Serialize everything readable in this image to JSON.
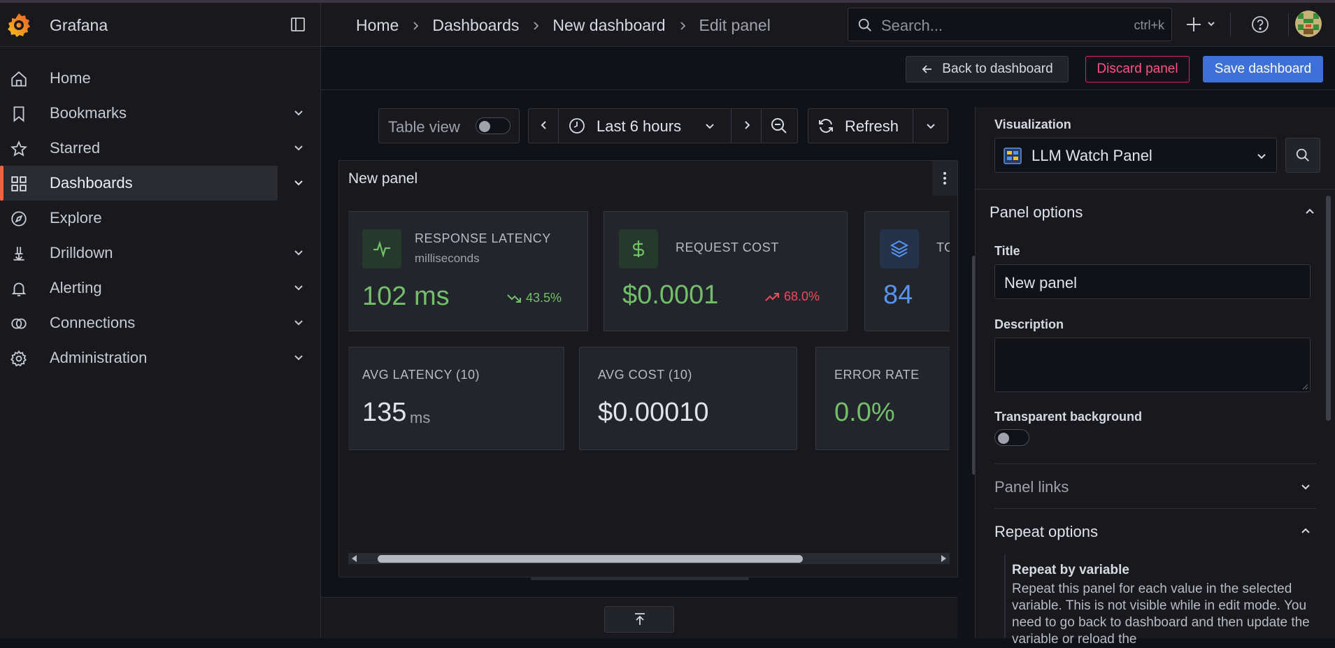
{
  "app": {
    "brand": "Grafana"
  },
  "sidebar": {
    "items": [
      {
        "label": "Home",
        "icon": "home-icon"
      },
      {
        "label": "Bookmarks",
        "icon": "bookmark-icon"
      },
      {
        "label": "Starred",
        "icon": "star-icon"
      },
      {
        "label": "Dashboards",
        "icon": "apps-icon",
        "active": true
      },
      {
        "label": "Explore",
        "icon": "compass-icon"
      },
      {
        "label": "Drilldown",
        "icon": "drilldown-icon"
      },
      {
        "label": "Alerting",
        "icon": "bell-icon"
      },
      {
        "label": "Connections",
        "icon": "link-icon"
      },
      {
        "label": "Administration",
        "icon": "cog-icon"
      }
    ]
  },
  "breadcrumb": [
    "Home",
    "Dashboards",
    "New dashboard",
    "Edit panel"
  ],
  "search": {
    "placeholder": "Search...",
    "shortcut": "ctrl+k"
  },
  "actions": {
    "back": "Back to dashboard",
    "discard": "Discard panel",
    "save": "Save dashboard"
  },
  "toolbar": {
    "table_view": "Table view",
    "time_range": "Last 6 hours",
    "refresh": "Refresh"
  },
  "panel": {
    "title": "New panel",
    "cards_top": [
      {
        "label": "RESPONSE LATENCY",
        "sub": "milliseconds",
        "value": "102 ms",
        "delta": "43.5%",
        "value_color": "#73bf69",
        "delta_color": "#73bf69",
        "icon": "pulse-icon"
      },
      {
        "label": "REQUEST COST",
        "value": "$0.0001",
        "delta": "68.0%",
        "value_color": "#73bf69",
        "delta_color": "#f2495c",
        "icon": "dollar-icon"
      },
      {
        "label": "TO",
        "value": "84",
        "value_color": "#5794f2",
        "icon": "layers-icon"
      }
    ],
    "cards_bottom": [
      {
        "label": "AVG LATENCY (10)",
        "value": "135",
        "unit": "ms",
        "value_color": "#e2e3ea"
      },
      {
        "label": "AVG COST (10)",
        "value": "$0.00010",
        "value_color": "#e2e3ea"
      },
      {
        "label": "ERROR RATE",
        "value": "0.0%",
        "value_color": "#73bf69"
      }
    ]
  },
  "options": {
    "visualization_label": "Visualization",
    "visualization_value": "LLM Watch Panel",
    "panel_options": "Panel options",
    "title_label": "Title",
    "title_value": "New panel",
    "description_label": "Description",
    "description_value": "",
    "transparent_label": "Transparent background",
    "panel_links": "Panel links",
    "repeat_options": "Repeat options",
    "repeat_by_label": "Repeat by variable",
    "repeat_help": "Repeat this panel for each value in the selected variable. This is not visible while in edit mode. You need to go back to dashboard and then update the variable or reload the"
  },
  "colors": {
    "accent": "#f0653d",
    "primary": "#3d71d9",
    "danger": "#ff5286",
    "green": "#73bf69",
    "red": "#f2495c",
    "blue": "#5794f2"
  }
}
